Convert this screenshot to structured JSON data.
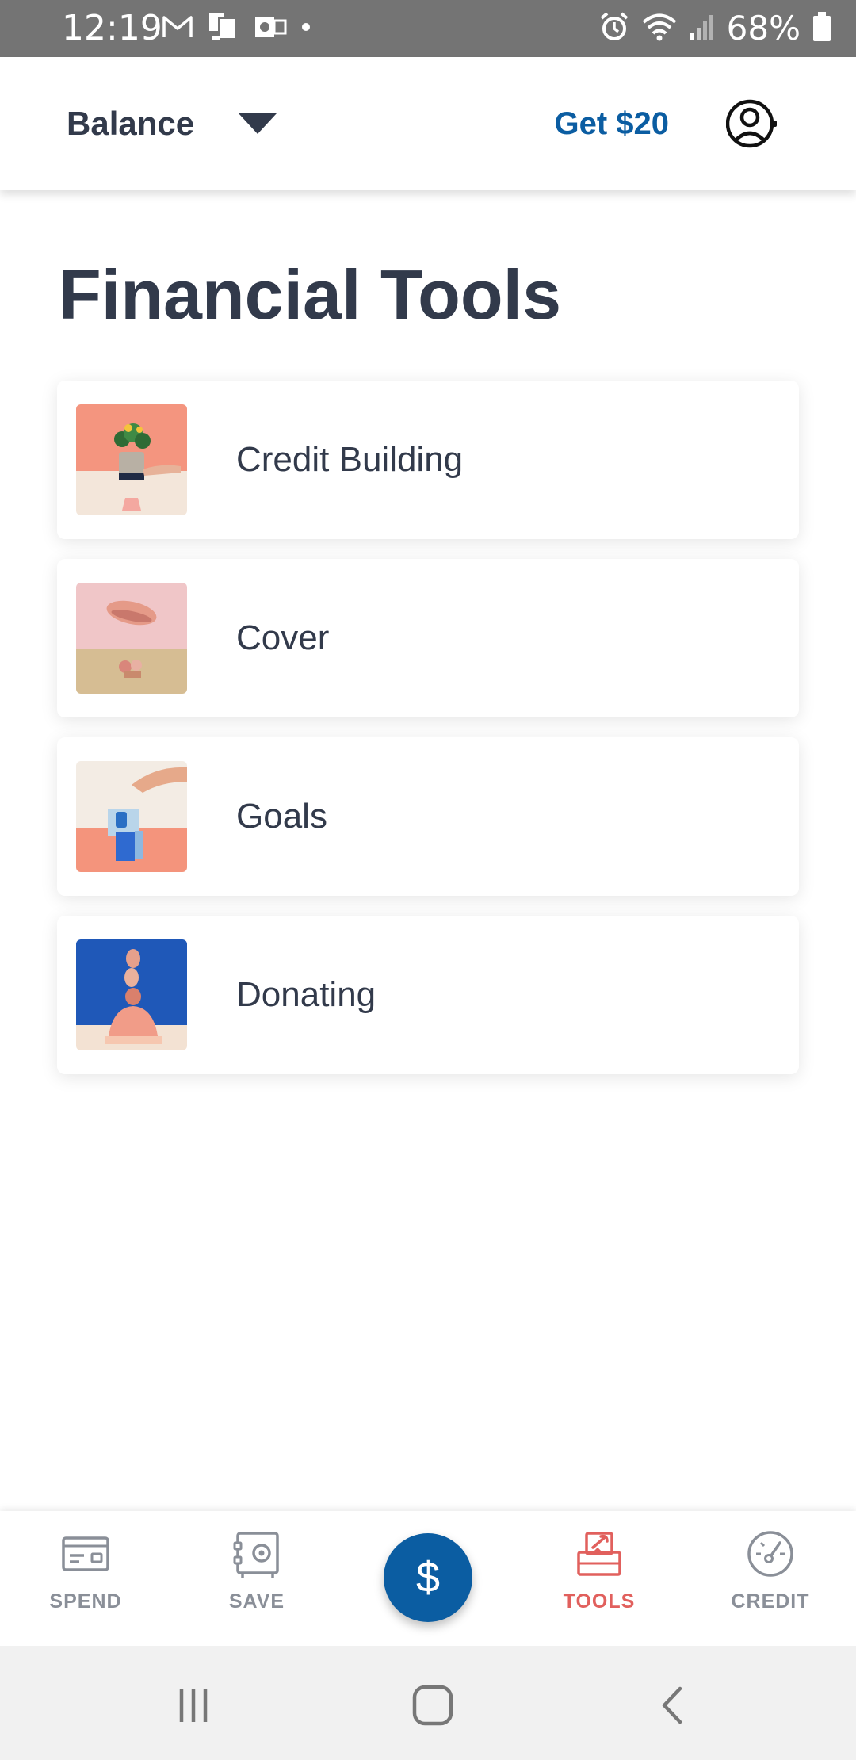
{
  "status_bar": {
    "time": "12:19",
    "battery": "68%",
    "left_icons": [
      "gmail-icon",
      "device-icon",
      "outlook-icon",
      "notification-dot-icon"
    ],
    "right_icons": [
      "alarm-icon",
      "wifi-icon",
      "signal-icon",
      "battery-icon"
    ]
  },
  "header": {
    "balance_label": "Balance",
    "referral_label": "Get $20",
    "profile_icon": "profile-icon",
    "accent_color": "#0b5da2"
  },
  "main": {
    "title": "Financial Tools",
    "tools": [
      {
        "label": "Credit Building",
        "thumb": "plant-pot-thumbnail"
      },
      {
        "label": "Cover",
        "thumb": "umbrella-thumbnail"
      },
      {
        "label": "Goals",
        "thumb": "blocks-thumbnail"
      },
      {
        "label": "Donating",
        "thumb": "stones-thumbnail"
      }
    ]
  },
  "bottom_nav": {
    "items": [
      {
        "label": "SPEND",
        "icon": "card-icon",
        "active": false
      },
      {
        "label": "SAVE",
        "icon": "vault-icon",
        "active": false
      },
      {
        "label": "TOOLS",
        "icon": "toolbox-icon",
        "active": true
      },
      {
        "label": "CREDIT",
        "icon": "gauge-icon",
        "active": false
      }
    ],
    "center_button": "$",
    "active_color": "#e1605d",
    "inactive_color": "#8a8f98"
  },
  "system_nav": {
    "buttons": [
      "recents-icon",
      "home-icon",
      "back-icon"
    ]
  }
}
